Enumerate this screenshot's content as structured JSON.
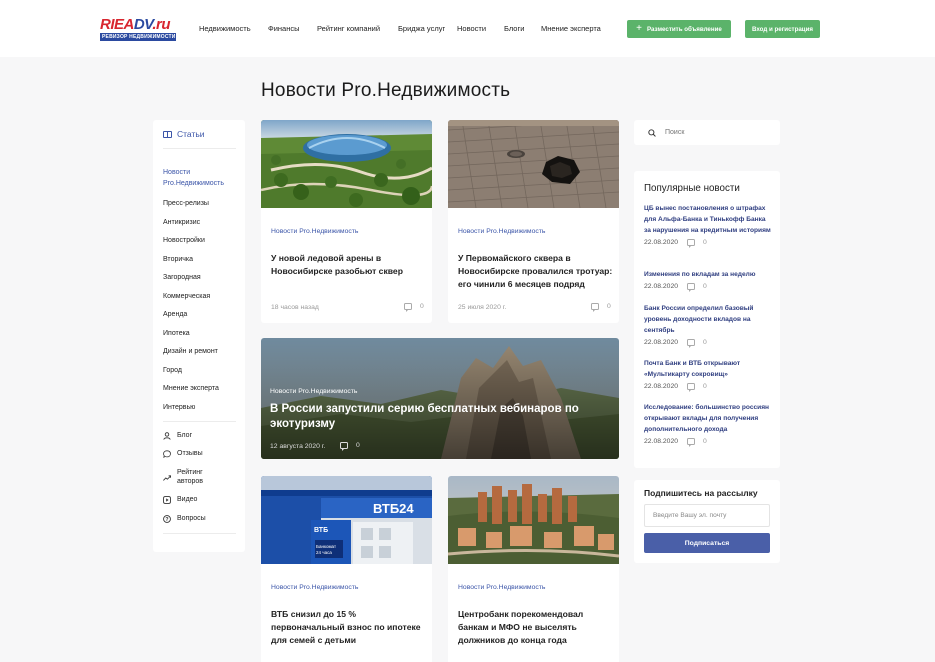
{
  "logo": {
    "main_1": "RIEA",
    "main_2": "DV",
    "tld": ".ru",
    "sub": "РЕВИЗОР НЕДВИЖИМОСТИ"
  },
  "nav": [
    "Недвижимость",
    "Финансы",
    "Рейтинг компаний",
    "Бриджа услуг",
    "Новости",
    "Блоги",
    "Мнение эксперта"
  ],
  "header": {
    "post_button": "Разместить объявление",
    "login_button": "Вход и регистрация"
  },
  "page_title": "Новости Pro.Недвижимость",
  "left_nav": {
    "articles": "Статьи",
    "items": [
      "Новости Pro.Недвижимость",
      "Пресс-релизы",
      "Антикризис",
      "Новостройки",
      "Вторичка",
      "Загородная",
      "Коммерческая",
      "Аренда",
      "Ипотека",
      "Дизайн и ремонт",
      "Город",
      "Мнение эксперта",
      "Интервью"
    ],
    "active_line1": "Новости",
    "active_line2": "Pro.Недвижимость",
    "icon_items": [
      {
        "label": "Блог",
        "icon": "user-icon"
      },
      {
        "label": "Отзывы",
        "icon": "chat-icon"
      },
      {
        "label_1": "Рейтинг",
        "label_2": "авторов",
        "icon": "trend-icon"
      },
      {
        "label": "Видео",
        "icon": "video-icon"
      },
      {
        "label": "Вопросы",
        "icon": "question-icon"
      }
    ]
  },
  "cards": [
    {
      "category": "Новости Pro.Недвижимость",
      "title": "У новой ледовой арены в Новосибирске разобьют сквер",
      "date": "18 часов назад",
      "comments": "0"
    },
    {
      "category": "Новости Pro.Недвижимость",
      "title": "У Первомайского сквера в Новосибирске провалился тротуар: его чинили 6 месяцев подряд",
      "date": "25 июля 2020 г.",
      "comments": "0"
    },
    {
      "category": "Новости Pro.Недвижимость",
      "title": "В России запустили серию бесплатных вебинаров по экотуризму",
      "date": "12 августа 2020 г.",
      "comments": "0"
    },
    {
      "category": "Новости Pro.Недвижимость",
      "title": "ВТБ снизил до 15 % первоначальный взнос по ипотеке для семей с детьми",
      "date": "",
      "comments": ""
    },
    {
      "category": "Новости Pro.Недвижимость",
      "title": "Центробанк порекомендовал банкам и МФО не выселять должников до конца года",
      "date": "",
      "comments": ""
    }
  ],
  "vtb_sign": {
    "top": "ВТБ24",
    "small": "ВТБ",
    "banner_1": "Банкомат",
    "banner_2": "24 часа"
  },
  "search": {
    "placeholder": "Поиск"
  },
  "popular": {
    "title": "Популярные новости",
    "items": [
      {
        "title": "ЦБ вынес постановления о штрафах для Альфа-Банка и Тинькофф Банка за нарушения на кредитным историям",
        "date": "22.08.2020",
        "comments": "0"
      },
      {
        "title": "Изменения по вкладам за неделю",
        "date": "22.08.2020",
        "comments": "0"
      },
      {
        "title": "Банк России определил базовый уровень доходности вкладов на сентябрь",
        "date": "22.08.2020",
        "comments": "0"
      },
      {
        "title": "Почта Банк и ВТБ открывают «Мультикарту сокровищ»",
        "date": "22.08.2020",
        "comments": "0"
      },
      {
        "title": "Исследование: большинство россиян открывают вклады для получения дополнительного дохода",
        "date": "22.08.2020",
        "comments": "0"
      }
    ]
  },
  "subscribe": {
    "title": "Подпишитесь на рассылку",
    "placeholder": "Введите Вашу эл. почту",
    "button": "Подписаться"
  },
  "colors": {
    "accent": "#3b55a8",
    "green": "#5bb36a",
    "button": "#4a5fa8"
  }
}
